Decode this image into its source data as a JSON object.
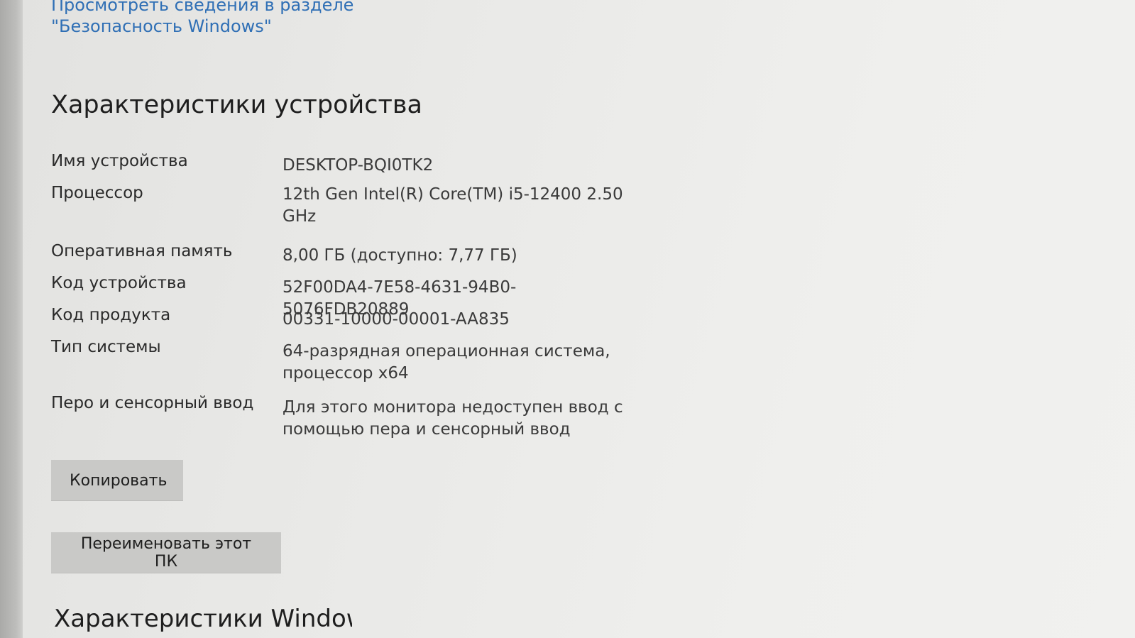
{
  "security_link": "Просмотреть сведения в разделе \"Безопасность Windows\"",
  "section_title": "Характеристики устройства",
  "specs": [
    {
      "label": "Имя устройства",
      "value": "DESKTOP-BQI0TK2"
    },
    {
      "label": "Процессор",
      "value": "12th Gen Intel(R) Core(TM) i5-12400   2.50 GHz"
    },
    {
      "label": "Оперативная память",
      "value": "8,00 ГБ (доступно: 7,77 ГБ)"
    },
    {
      "label": "Код устройства",
      "value": "52F00DA4-7E58-4631-94B0-5076FDB20889"
    },
    {
      "label": "Код продукта",
      "value": "00331-10000-00001-AA835"
    },
    {
      "label": "Тип системы",
      "value": "64-разрядная операционная система, процессор x64"
    },
    {
      "label": "Перо и сенсорный ввод",
      "value": "Для этого монитора недоступен ввод с помощью пера и сенсорный ввод"
    }
  ],
  "buttons": {
    "copy": "Копировать",
    "rename": "Переименовать этот ПК"
  },
  "next_section_title": "Характеристики Windows"
}
